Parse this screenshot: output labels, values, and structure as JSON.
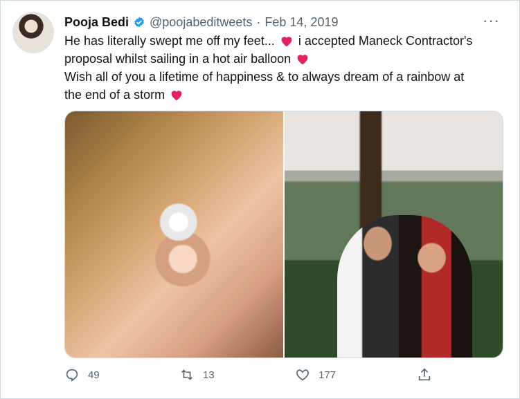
{
  "tweet": {
    "author_name": "Pooja Bedi",
    "handle": "@poojabeditweets",
    "separator": "·",
    "date": "Feb 14, 2019",
    "more_label": "···",
    "text": {
      "line1": "He has literally  swept me off my feet...",
      "line2a": " i accepted Maneck Contractor's",
      "line2b": "proposal whilst sailing in a hot air balloon",
      "line3": "Wish all of you a lifetime of happiness & to always dream of a rainbow at",
      "line4": "the end of a storm"
    },
    "stats": {
      "replies": "49",
      "retweets": "13",
      "likes": "177"
    }
  },
  "icons": {
    "verified": "verified-badge",
    "heart_emoji": "red-heart",
    "reply": "reply-icon",
    "retweet": "retweet-icon",
    "like": "like-icon",
    "share": "share-icon"
  },
  "colors": {
    "verified_blue": "#1d9bf0",
    "heart_red": "#e0245e",
    "secondary_text": "#536471",
    "border": "#cfd9de"
  }
}
